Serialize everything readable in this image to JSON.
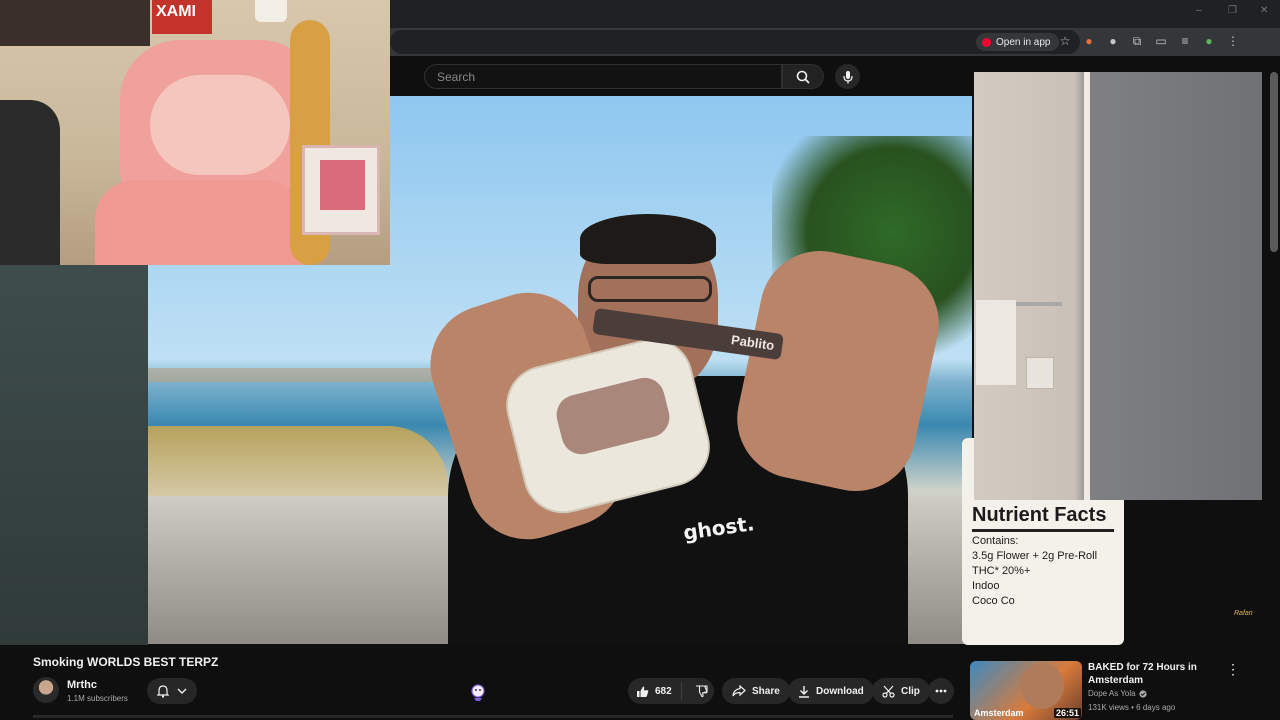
{
  "browser": {
    "open_in_app_label": "Open in app",
    "toolbar_icons": [
      "star-icon",
      "brave-icon",
      "extension-icon",
      "puzzle-icon",
      "cast-icon",
      "playlist-icon",
      "profile-icon",
      "kebab-icon"
    ]
  },
  "header": {
    "search_placeholder": "Search"
  },
  "video": {
    "shirt_text": "ghost.",
    "preroll_text": "Pablito",
    "can": {
      "title": "Nutrient Facts",
      "line1": "Contains:",
      "line2": "3.5g Flower + 2g Pre-Roll",
      "line3": "THC* 20%+",
      "line4": "Indoo",
      "line5": "Coco Co"
    },
    "room_poster_text": "XAMI",
    "watermark": "Rafan"
  },
  "info": {
    "title": "Smoking WORLDS BEST TERPZ",
    "channel": "Mrthc",
    "subscribers": "1.1M subscribers",
    "likes": "682",
    "share_label": "Share",
    "download_label": "Download",
    "clip_label": "Clip"
  },
  "recommendation": {
    "title": "BAKED for 72 Hours in Amsterdam",
    "channel": "Dope As Yola",
    "meta": "131K views • 6 days ago",
    "thumb_caption": "Amsterdam",
    "duration": "26:51"
  },
  "colors": {
    "background": "#0f0f0f",
    "pill": "#272727",
    "accent_red": "#ff0033",
    "secondary_text": "#aaaaaa"
  }
}
